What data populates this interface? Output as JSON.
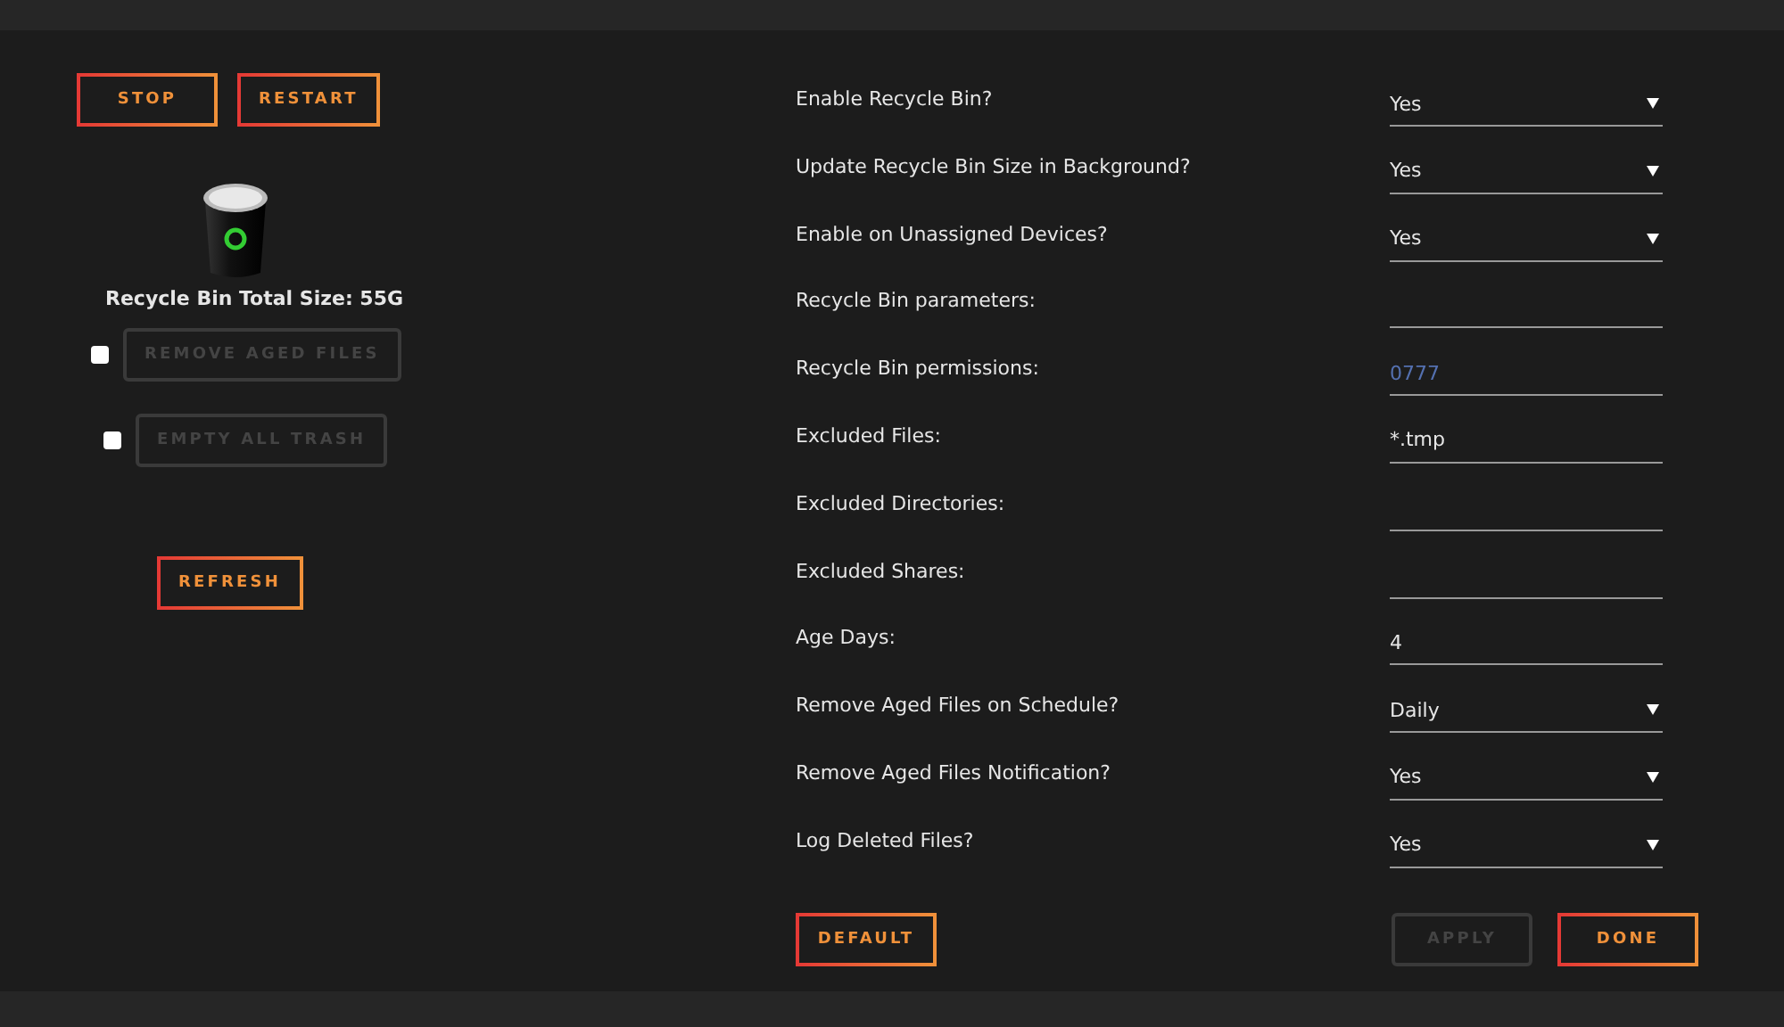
{
  "top_buttons": [
    {
      "label": "STOP",
      "disabled": false
    },
    {
      "label": "RESTART",
      "disabled": false
    }
  ],
  "bin": {
    "caption": "Recycle Bin Total Size: 55G"
  },
  "actions": [
    {
      "label": "REMOVE AGED FILES",
      "checked": false,
      "disabled": true
    },
    {
      "label": "EMPTY ALL TRASH",
      "checked": false,
      "disabled": true
    }
  ],
  "refresh": {
    "label": "REFRESH",
    "disabled": false
  },
  "settings": [
    {
      "label": "Enable Recycle Bin?",
      "kind": "select",
      "value": "Yes"
    },
    {
      "label": "Update Recycle Bin Size in Background?",
      "kind": "select",
      "value": "Yes"
    },
    {
      "label": "Enable on Unassigned Devices?",
      "kind": "select",
      "value": "Yes"
    },
    {
      "label": "Recycle Bin parameters:",
      "kind": "text"
    },
    {
      "label": "Recycle Bin permissions:",
      "kind": "text",
      "placeholder": "0777"
    },
    {
      "label": "Excluded Files:",
      "kind": "text",
      "value": "*.tmp"
    },
    {
      "label": "Excluded Directories:",
      "kind": "text"
    },
    {
      "label": "Excluded Shares:",
      "kind": "text"
    },
    {
      "label": "Age Days:",
      "kind": "text",
      "value": "4"
    },
    {
      "label": "Remove Aged Files on Schedule?",
      "kind": "select",
      "value": "Daily"
    },
    {
      "label": "Remove Aged Files Notification?",
      "kind": "select",
      "value": "Yes"
    },
    {
      "label": "Log Deleted Files?",
      "kind": "select",
      "value": "Yes"
    }
  ],
  "footer": {
    "default": {
      "label": "DEFAULT",
      "disabled": false
    },
    "right": [
      {
        "label": "APPLY",
        "disabled": true
      },
      {
        "label": "DONE",
        "disabled": false
      }
    ]
  }
}
